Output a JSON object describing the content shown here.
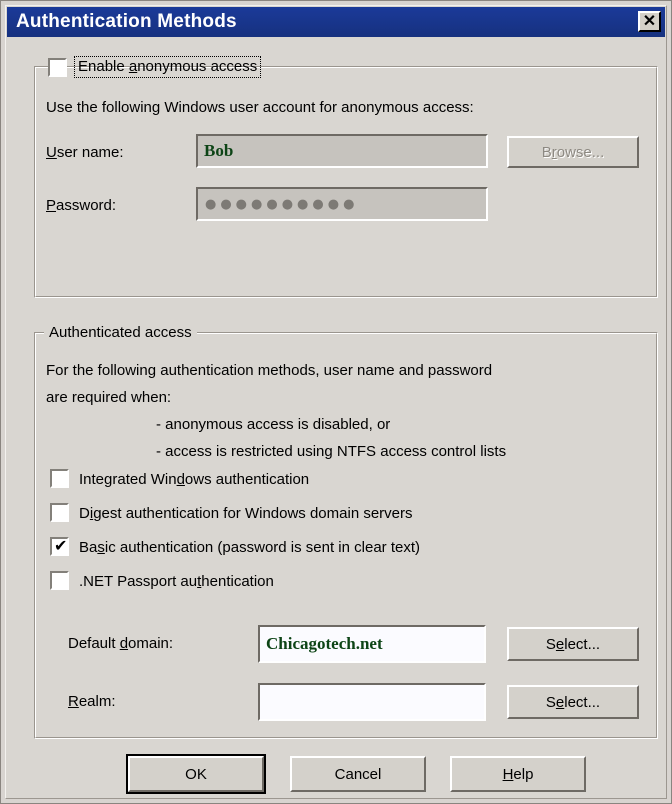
{
  "window": {
    "title": "Authentication Methods",
    "close_icon": "close-icon",
    "close_glyph": "✕",
    "titlebar_color": "#17348c",
    "face_color": "#d9d6d1"
  },
  "anonymous_group": {
    "checkbox": {
      "label_pre": "Enable ",
      "label_accel": "a",
      "label_post": "nonymous access",
      "checked": false,
      "focused": true
    },
    "description": "Use the following Windows user account for anonymous access:",
    "username": {
      "label_pre": "U",
      "label_accel": "",
      "label_post": "ser name:",
      "label_full": "User name:",
      "value": "Bob",
      "value_color": "#0d4416",
      "selected": true
    },
    "password": {
      "label_full": "Password:",
      "masked_value": "●●●●●●●●●●",
      "dot_count": 10
    },
    "browse_button": {
      "label_pre": "B",
      "label_accel": "r",
      "label_post": "owse...",
      "label_full": "Browse...",
      "disabled": true
    }
  },
  "authenticated_group": {
    "legend": "Authenticated access",
    "intro_line1": "For the following authentication methods, user name and password",
    "intro_line2": "are required when:",
    "bullet1": "- anonymous access is disabled, or",
    "bullet2": "- access is restricted using NTFS access control lists",
    "methods": [
      {
        "id": "integrated-windows",
        "label_pre": "Integrated Win",
        "label_accel": "d",
        "label_post": "ows authentication",
        "checked": false
      },
      {
        "id": "digest",
        "label_pre": "D",
        "label_accel": "i",
        "label_post": "gest authentication for Windows domain servers",
        "checked": false
      },
      {
        "id": "basic",
        "label_pre": "Ba",
        "label_accel": "s",
        "label_post": "ic authentication (password is sent in clear text)",
        "checked": true,
        "check_glyph": "✔"
      },
      {
        "id": "net-passport",
        "label_pre": ".NET Passport au",
        "label_accel": "t",
        "label_post": "hentication",
        "checked": false
      }
    ],
    "default_domain": {
      "label_pre": "Default ",
      "label_accel": "d",
      "label_post": "omain:",
      "value": "Chicagotech.net",
      "value_color": "#0d4416"
    },
    "realm": {
      "label_pre": "",
      "label_accel": "R",
      "label_post": "ealm:",
      "value": ""
    },
    "select_button_domain": {
      "label_pre": "S",
      "label_accel": "e",
      "label_post": "lect...",
      "label_full": "Select..."
    },
    "select_button_realm": {
      "label_pre": "S",
      "label_accel": "e",
      "label_post": "lect...",
      "label_full": "Select..."
    }
  },
  "footer": {
    "ok": {
      "label": "OK",
      "is_default": true
    },
    "cancel": {
      "label": "Cancel"
    },
    "help": {
      "label_pre": "",
      "label_accel": "H",
      "label_post": "elp",
      "label_full": "Help"
    }
  }
}
